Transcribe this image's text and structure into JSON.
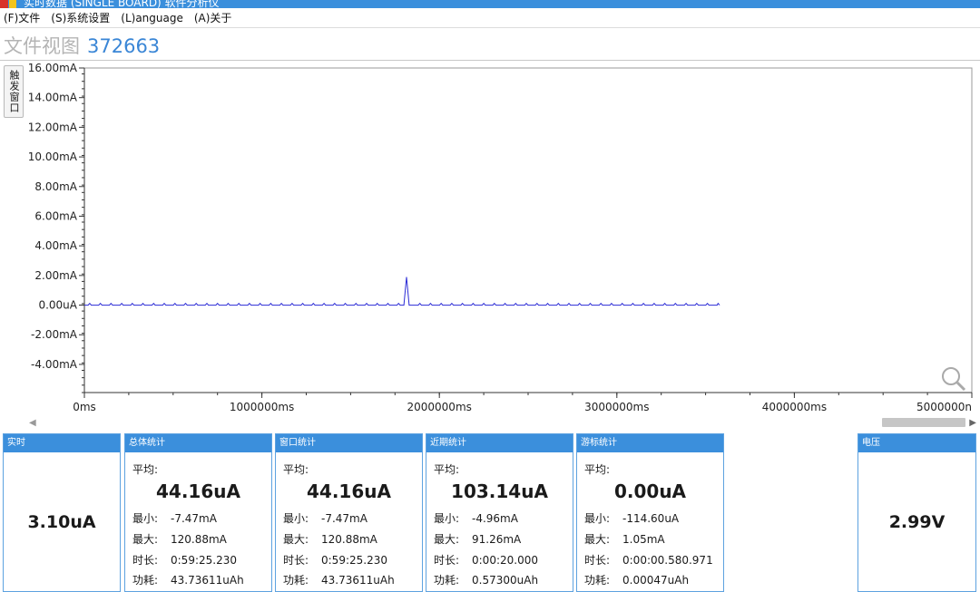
{
  "window": {
    "title": "实时数据 (SINGLE BOARD) 软件分析仪"
  },
  "menu": [
    {
      "label": "(F)文件"
    },
    {
      "label": "(S)系统设置"
    },
    {
      "label": "(L)anguage"
    },
    {
      "label": "(A)关于"
    }
  ],
  "view": {
    "label": "文件视图",
    "number": "372663"
  },
  "trigger_tab": "触发窗口",
  "chart_data": {
    "type": "line",
    "title": "",
    "xlabel": "",
    "ylabel": "",
    "y_tick_labels": [
      "16.00mA",
      "14.00mA",
      "12.00mA",
      "10.00mA",
      "8.00mA",
      "6.00mA",
      "4.00mA",
      "2.00mA",
      "0.00uA",
      "-2.00mA",
      "-4.00mA"
    ],
    "y_tick_values": [
      16,
      14,
      12,
      10,
      8,
      6,
      4,
      2,
      0,
      -2,
      -4
    ],
    "x_tick_labels": [
      "0ms",
      "1000000ms",
      "2000000ms",
      "3000000ms",
      "4000000ms",
      "5000000n"
    ],
    "x_tick_values": [
      0,
      1000000,
      2000000,
      3000000,
      4000000,
      5000000
    ],
    "ylim": [
      -5.9,
      16
    ],
    "xlim": [
      0,
      5000000
    ],
    "y_unit": "mA",
    "x_unit": "ms",
    "line_color": "#2b2bd6",
    "grid": false,
    "series": [
      {
        "spike_interval_ms": 60000,
        "spike_height_mA": 0.12,
        "baseline_mA": 0.0,
        "end_ms": 3565000,
        "main_spike_ms": 1815000,
        "main_spike_height_mA": 1.9
      }
    ]
  },
  "stats": {
    "realtime": {
      "header": "实时",
      "value": "3.10uA"
    },
    "total": {
      "header": "总体统计",
      "avg_label": "平均:",
      "avg": "44.16uA",
      "min_label": "最小:",
      "min": "-7.47mA",
      "max_label": "最大:",
      "max": "120.88mA",
      "dur_label": "时长:",
      "dur": "0:59:25.230",
      "energy_label": "功耗:",
      "energy": "43.73611uAh"
    },
    "window": {
      "header": "窗口统计",
      "avg_label": "平均:",
      "avg": "44.16uA",
      "min_label": "最小:",
      "min": "-7.47mA",
      "max_label": "最大:",
      "max": "120.88mA",
      "dur_label": "时长:",
      "dur": "0:59:25.230",
      "energy_label": "功耗:",
      "energy": "43.73611uAh"
    },
    "recent": {
      "header": "近期统计",
      "avg_label": "平均:",
      "avg": "103.14uA",
      "min_label": "最小:",
      "min": "-4.96mA",
      "max_label": "最大:",
      "max": "91.26mA",
      "dur_label": "时长:",
      "dur": "0:00:20.000",
      "energy_label": "功耗:",
      "energy": "0.57300uAh"
    },
    "cursor": {
      "header": "游标统计",
      "avg_label": "平均:",
      "avg": "0.00uA",
      "min_label": "最小:",
      "min": "-114.60uA",
      "max_label": "最大:",
      "max": "1.05mA",
      "dur_label": "时长:",
      "dur": "0:00:00.580.971",
      "energy_label": "功耗:",
      "energy": "0.00047uAh"
    },
    "voltage": {
      "header": "电压",
      "value": "2.99V"
    }
  }
}
